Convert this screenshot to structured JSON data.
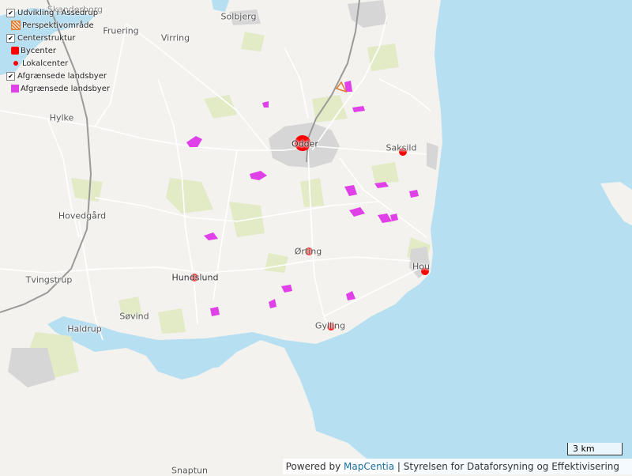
{
  "legend": [
    {
      "label": "Udvikling i Assedrup",
      "type": "group"
    },
    {
      "label": "Perspektivområde",
      "type": "hatch",
      "color": "#e07a2e"
    },
    {
      "label": "Centerstruktur",
      "type": "group"
    },
    {
      "label": "Bycenter",
      "type": "square",
      "color": "#ff0000"
    },
    {
      "label": "Lokalcenter",
      "type": "dot",
      "color": "#ff0000"
    },
    {
      "label": "Afgrænsede landsbyer",
      "type": "group"
    },
    {
      "label": "Afgrænsede landsbyer",
      "type": "fill",
      "color": "#e040e8"
    }
  ],
  "places": [
    "Skanderborg",
    "Solbjerg",
    "Fruering",
    "Virring",
    "Hylke",
    "Odder",
    "Saksild",
    "Hovedgård",
    "Ørting",
    "Hou",
    "Tvingstrup",
    "Hundslund",
    "Søvind",
    "Haldrup",
    "Gylling",
    "Snaptun"
  ],
  "centers": [
    {
      "name": "Odder",
      "kind": "bycenter"
    },
    {
      "name": "Saksild",
      "kind": "lokalcenter"
    },
    {
      "name": "Ørting",
      "kind": "lokalcenter"
    },
    {
      "name": "Hou",
      "kind": "lokalcenter"
    },
    {
      "name": "Hundslund",
      "kind": "lokalcenter"
    },
    {
      "name": "Gylling",
      "kind": "lokalcenter"
    }
  ],
  "scale_label": "3 km",
  "attribution": {
    "prefix": "Powered by ",
    "link": "MapCentia",
    "suffix": " | Styrelsen for Dataforsyning og Effektivisering"
  },
  "colors": {
    "water": "#b7dff2",
    "land": "#f3f2ee",
    "road": "#ffffff",
    "forest": "#e2ebc6",
    "town": "#d6d6d6",
    "village": "#e040e8",
    "center": "#ff0000"
  }
}
